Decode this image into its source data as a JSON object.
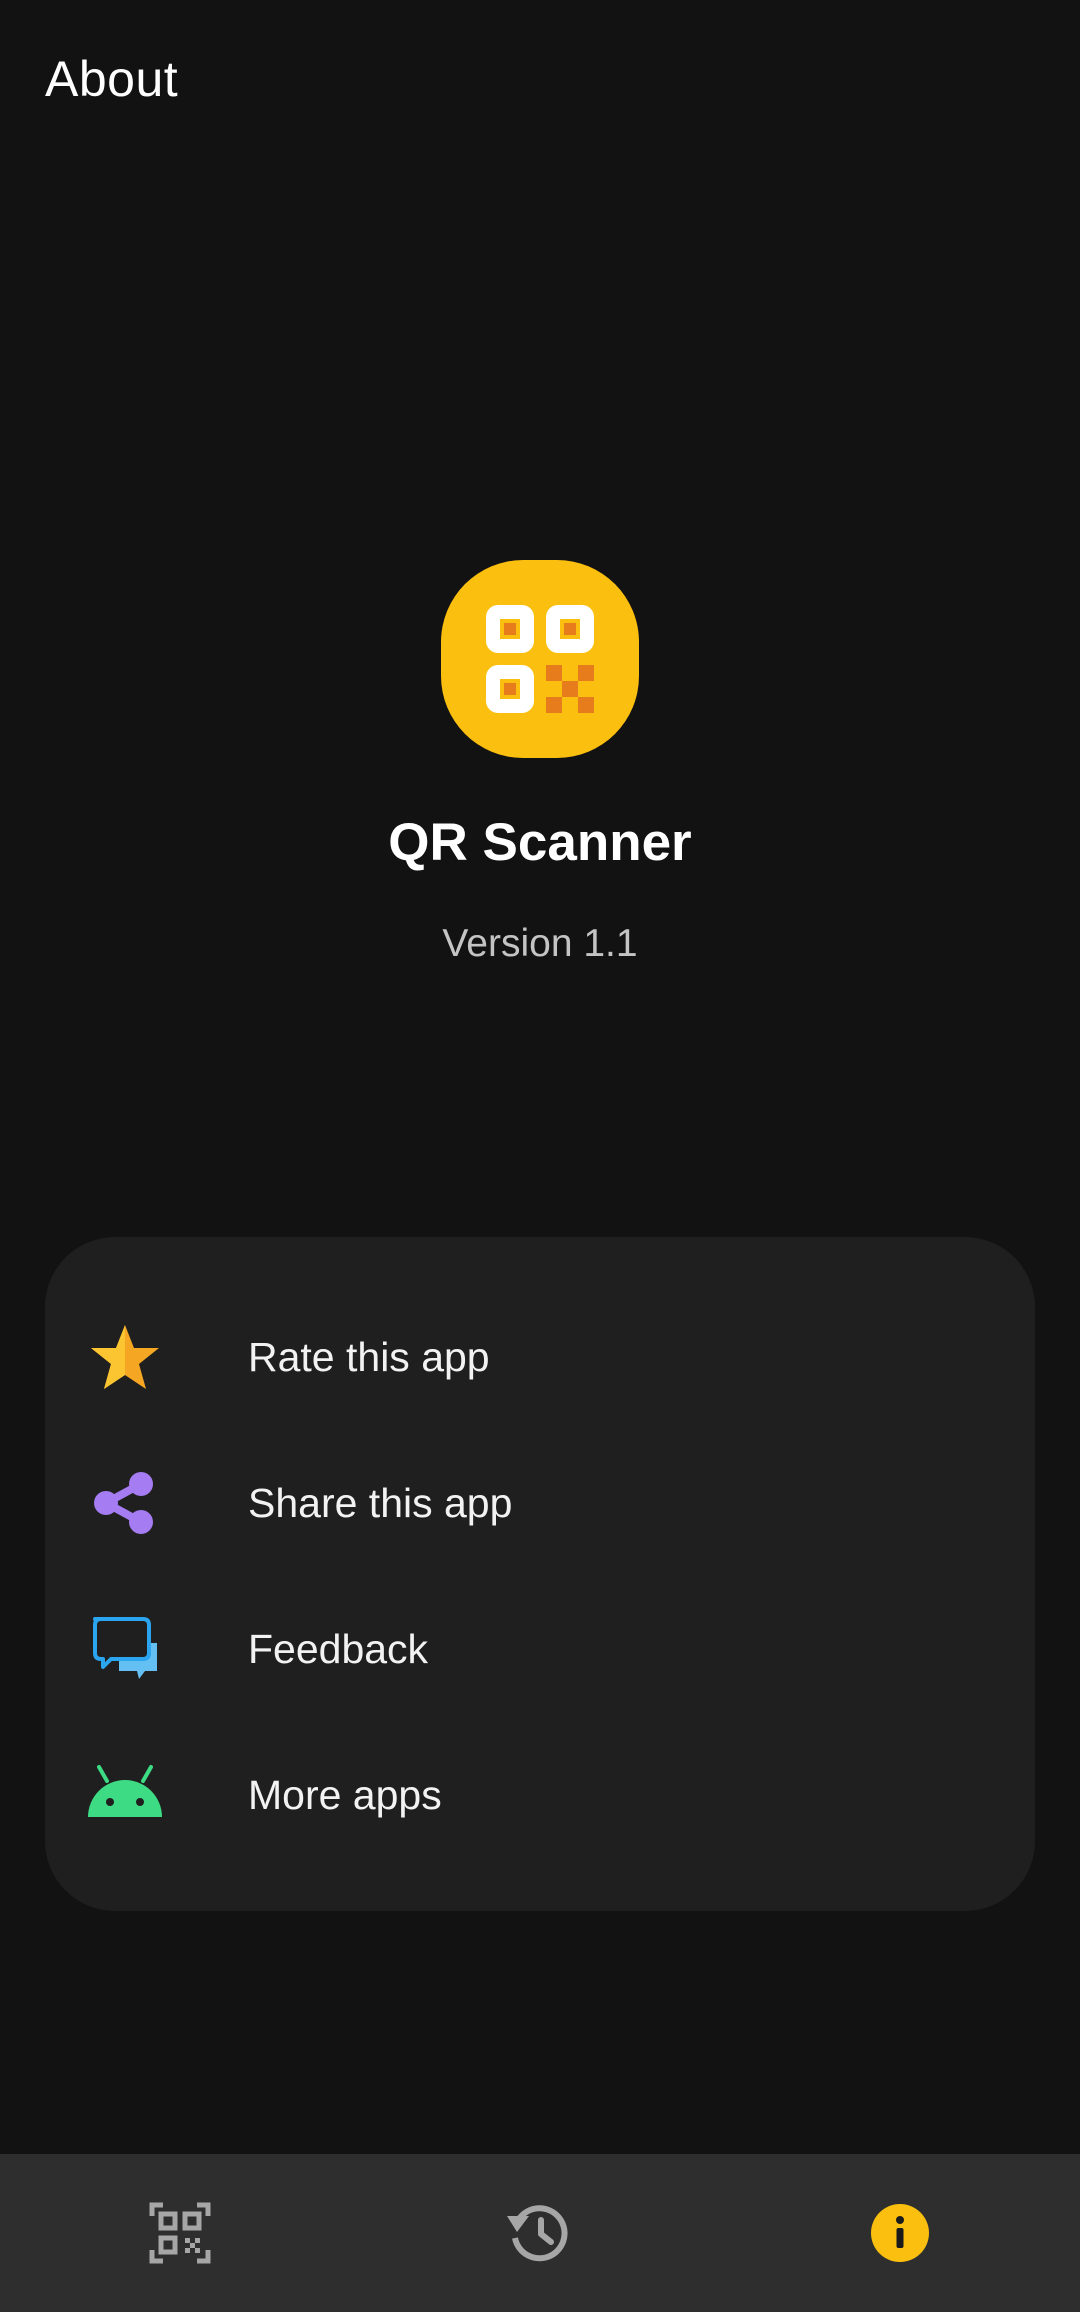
{
  "header": {
    "title": "About"
  },
  "app": {
    "logo_icon": "qr-code-logo-icon",
    "name": "QR Scanner",
    "version": "Version 1.1"
  },
  "menu": {
    "items": [
      {
        "label": "Rate this app",
        "icon": "star-icon"
      },
      {
        "label": "Share this app",
        "icon": "share-icon"
      },
      {
        "label": "Feedback",
        "icon": "chat-bubbles-icon"
      },
      {
        "label": "More apps",
        "icon": "android-icon"
      }
    ]
  },
  "bottom_nav": {
    "items": [
      {
        "icon": "qr-scan-icon",
        "active": false
      },
      {
        "icon": "history-icon",
        "active": false
      },
      {
        "icon": "info-icon",
        "active": true
      }
    ]
  },
  "colors": {
    "background": "#121212",
    "card": "#1f1f1f",
    "nav_bar": "#2e2e2e",
    "accent": "#fbbf0f",
    "secondary_text": "#c4c4c4"
  }
}
